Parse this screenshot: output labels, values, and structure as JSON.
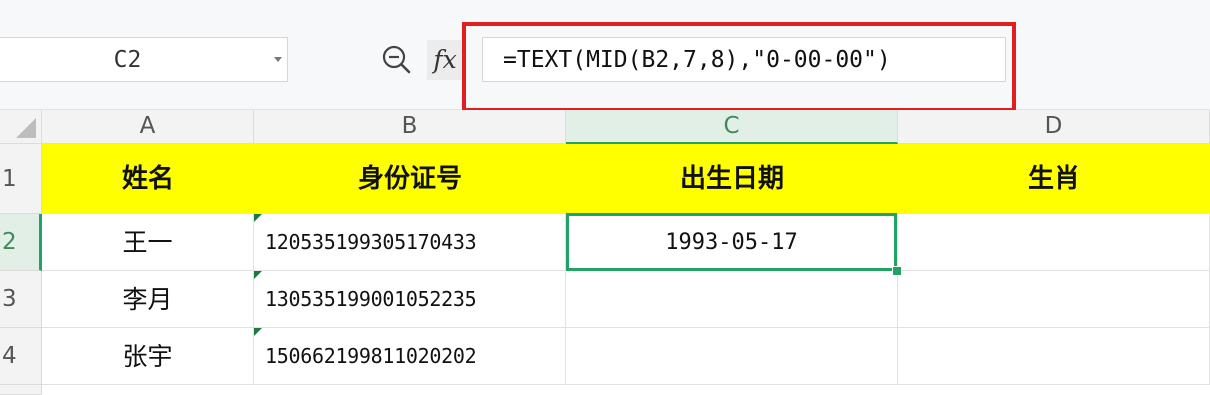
{
  "formula_bar": {
    "name_box": "C2",
    "fx_label": "fx",
    "formula": "=TEXT(MID(B2,7,8),\"0-00-00\")"
  },
  "columns": [
    "A",
    "B",
    "C",
    "D"
  ],
  "rows": [
    "1",
    "2",
    "3",
    "4"
  ],
  "header_row": {
    "name": "姓名",
    "id_number": "身份证号",
    "birth_date": "出生日期",
    "zodiac": "生肖"
  },
  "data_rows": [
    {
      "name": "王一",
      "id_number": "120535199305170433",
      "birth_date": "1993-05-17",
      "zodiac": ""
    },
    {
      "name": "李月",
      "id_number": "130535199001052235",
      "birth_date": "",
      "zodiac": ""
    },
    {
      "name": "张宇",
      "id_number": "150662199811020202",
      "birth_date": "",
      "zodiac": ""
    }
  ],
  "selected_cell": "C2",
  "colors": {
    "header_fill": "#ffff00",
    "selection_green": "#21a366",
    "highlight_box": "#e02020"
  }
}
